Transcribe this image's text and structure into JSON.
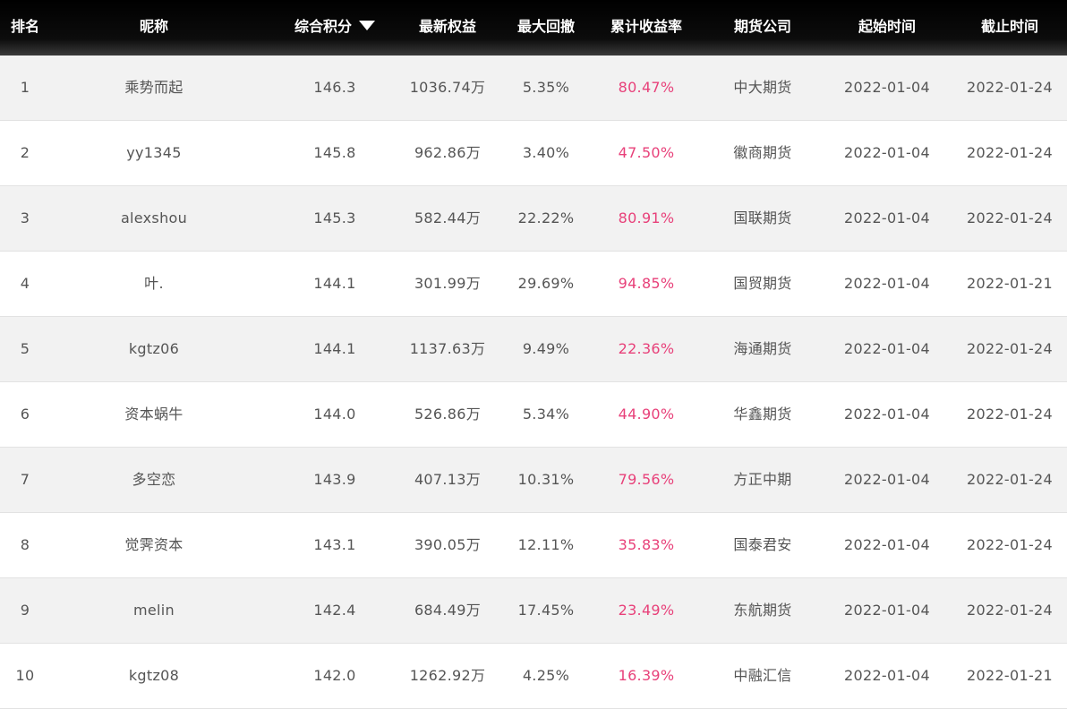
{
  "header": {
    "rank": "排名",
    "nickname": "昵称",
    "score": "综合积分",
    "score_sort_icon": "triangle-down-icon",
    "equity": "最新权益",
    "drawdown": "最大回撤",
    "return_rate": "累计收益率",
    "company": "期货公司",
    "start": "起始时间",
    "end": "截止时间"
  },
  "colors": {
    "header_bg": "#000000",
    "rate_text": "#e8417a",
    "row_alt_bg": "#f2f2f2",
    "cell_text": "#555555"
  },
  "rows": [
    {
      "rank": "1",
      "nickname": "乘势而起",
      "score": "146.3",
      "equity": "1036.74万",
      "drawdown": "5.35%",
      "return_rate": "80.47%",
      "company": "中大期货",
      "start": "2022-01-04",
      "end": "2022-01-24"
    },
    {
      "rank": "2",
      "nickname": "yy1345",
      "score": "145.8",
      "equity": "962.86万",
      "drawdown": "3.40%",
      "return_rate": "47.50%",
      "company": "徽商期货",
      "start": "2022-01-04",
      "end": "2022-01-24"
    },
    {
      "rank": "3",
      "nickname": "alexshou",
      "score": "145.3",
      "equity": "582.44万",
      "drawdown": "22.22%",
      "return_rate": "80.91%",
      "company": "国联期货",
      "start": "2022-01-04",
      "end": "2022-01-24"
    },
    {
      "rank": "4",
      "nickname": "叶.",
      "score": "144.1",
      "equity": "301.99万",
      "drawdown": "29.69%",
      "return_rate": "94.85%",
      "company": "国贸期货",
      "start": "2022-01-04",
      "end": "2022-01-21"
    },
    {
      "rank": "5",
      "nickname": "kgtz06",
      "score": "144.1",
      "equity": "1137.63万",
      "drawdown": "9.49%",
      "return_rate": "22.36%",
      "company": "海通期货",
      "start": "2022-01-04",
      "end": "2022-01-24"
    },
    {
      "rank": "6",
      "nickname": "资本蜗牛",
      "score": "144.0",
      "equity": "526.86万",
      "drawdown": "5.34%",
      "return_rate": "44.90%",
      "company": "华鑫期货",
      "start": "2022-01-04",
      "end": "2022-01-24"
    },
    {
      "rank": "7",
      "nickname": "多空恋",
      "score": "143.9",
      "equity": "407.13万",
      "drawdown": "10.31%",
      "return_rate": "79.56%",
      "company": "方正中期",
      "start": "2022-01-04",
      "end": "2022-01-24"
    },
    {
      "rank": "8",
      "nickname": "觉霁资本",
      "score": "143.1",
      "equity": "390.05万",
      "drawdown": "12.11%",
      "return_rate": "35.83%",
      "company": "国泰君安",
      "start": "2022-01-04",
      "end": "2022-01-24"
    },
    {
      "rank": "9",
      "nickname": "melin",
      "score": "142.4",
      "equity": "684.49万",
      "drawdown": "17.45%",
      "return_rate": "23.49%",
      "company": "东航期货",
      "start": "2022-01-04",
      "end": "2022-01-24"
    },
    {
      "rank": "10",
      "nickname": "kgtz08",
      "score": "142.0",
      "equity": "1262.92万",
      "drawdown": "4.25%",
      "return_rate": "16.39%",
      "company": "中融汇信",
      "start": "2022-01-04",
      "end": "2022-01-21"
    }
  ]
}
